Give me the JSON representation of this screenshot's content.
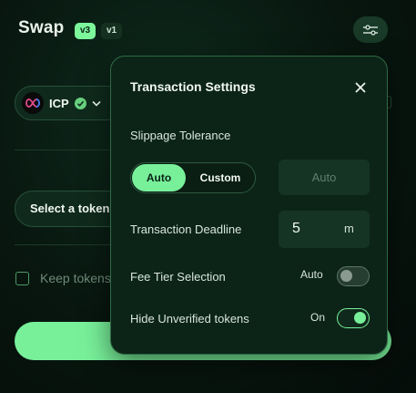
{
  "header": {
    "title": "Swap",
    "version_active": "v3",
    "version_other": "v1"
  },
  "swap": {
    "from_token": "ICP",
    "select_token": "Select a token",
    "keep_tokens_label": "Keep tokens"
  },
  "settings": {
    "title": "Transaction Settings",
    "slippage_label": "Slippage Tolerance",
    "slippage_auto": "Auto",
    "slippage_custom": "Custom",
    "slippage_placeholder": "Auto",
    "deadline_label": "Transaction Deadline",
    "deadline_value": "5",
    "deadline_unit": "m",
    "fee_tier_label": "Fee Tier Selection",
    "fee_tier_status": "Auto",
    "hide_unverified_label": "Hide Unverified tokens",
    "hide_unverified_status": "On"
  },
  "colors": {
    "accent": "#78f09a",
    "background": "#08160f",
    "panel": "#0c2418"
  },
  "icons": [
    "settings-sliders-icon",
    "icp-logo-icon",
    "verified-check-icon",
    "chevron-down-icon",
    "close-icon"
  ]
}
